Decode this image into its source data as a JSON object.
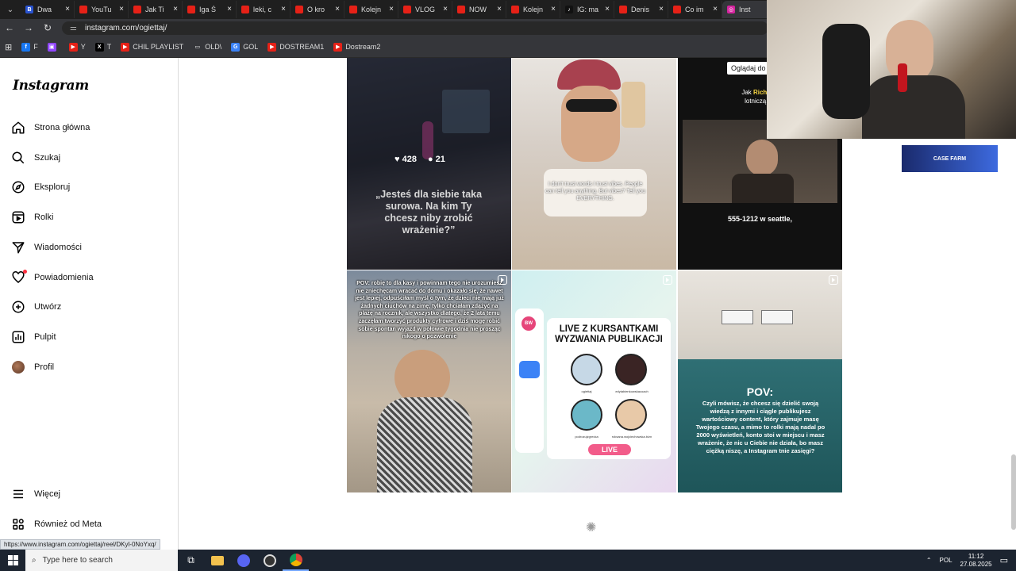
{
  "browser": {
    "tabs": [
      {
        "label": "Dwa",
        "fav_color": "#2a54d1",
        "fav_glyph": "B"
      },
      {
        "label": "YouTu",
        "fav_color": "#e62117",
        "fav_glyph": ""
      },
      {
        "label": "Jak Ti",
        "fav_color": "#e62117",
        "fav_glyph": ""
      },
      {
        "label": "Iga Ś",
        "fav_color": "#e62117",
        "fav_glyph": ""
      },
      {
        "label": "leki, c",
        "fav_color": "#e62117",
        "fav_glyph": ""
      },
      {
        "label": "O kro",
        "fav_color": "#e62117",
        "fav_glyph": ""
      },
      {
        "label": "Kolejn",
        "fav_color": "#e62117",
        "fav_glyph": ""
      },
      {
        "label": "VLOG",
        "fav_color": "#e62117",
        "fav_glyph": ""
      },
      {
        "label": "NOW",
        "fav_color": "#e62117",
        "fav_glyph": ""
      },
      {
        "label": "Kolejn",
        "fav_color": "#e62117",
        "fav_glyph": ""
      },
      {
        "label": "IG: ma",
        "fav_color": "#111111",
        "fav_glyph": "♪"
      },
      {
        "label": "Denis",
        "fav_color": "#e62117",
        "fav_glyph": ""
      },
      {
        "label": "Co im",
        "fav_color": "#e62117",
        "fav_glyph": ""
      },
      {
        "label": "Inst",
        "fav_color": "#d6249f",
        "fav_glyph": "◎",
        "active": true
      }
    ],
    "url": "instagram.com/ogiettaj/",
    "bookmarks": [
      {
        "label": "F",
        "fav_color": "#1877f2",
        "fav_glyph": "f"
      },
      {
        "label": "",
        "fav_color": "#9146ff",
        "fav_glyph": "▣"
      },
      {
        "label": "Y",
        "fav_color": "#e62117",
        "fav_glyph": "▶"
      },
      {
        "label": "T",
        "fav_color": "#000000",
        "fav_glyph": "X"
      },
      {
        "label": "CHIL PLAYLIST",
        "fav_color": "#e62117",
        "fav_glyph": "▶"
      },
      {
        "label": "OLD\\",
        "fav_color": "transparent",
        "fav_glyph": "▭"
      },
      {
        "label": "GOL",
        "fav_color": "#3b82f6",
        "fav_glyph": "G"
      },
      {
        "label": "DOSTREAM1",
        "fav_color": "#e62117",
        "fav_glyph": "▶"
      },
      {
        "label": "Dostream2",
        "fav_color": "#e62117",
        "fav_glyph": "▶"
      }
    ]
  },
  "instagram": {
    "logo": "Instagram",
    "nav": [
      {
        "label": "Strona główna",
        "icon": "home-icon"
      },
      {
        "label": "Szukaj",
        "icon": "search-icon"
      },
      {
        "label": "Eksploruj",
        "icon": "explore-icon"
      },
      {
        "label": "Rolki",
        "icon": "reels-icon"
      },
      {
        "label": "Wiadomości",
        "icon": "messages-icon"
      },
      {
        "label": "Powiadomienia",
        "icon": "heart-icon"
      },
      {
        "label": "Utwórz",
        "icon": "create-icon"
      },
      {
        "label": "Pulpit",
        "icon": "dashboard-icon"
      },
      {
        "label": "Profil",
        "icon": "avatar"
      }
    ],
    "more": "Więcej",
    "also_meta": "Również od Meta",
    "posts": [
      {
        "overlay": "„Jesteś dla siebie taka surowa. Na kim Ty chcesz niby zrobić wrażenie?”",
        "likes": "428",
        "comments": "21"
      },
      {
        "overlay": "I don't trust words I trust vibes. People can tell you anything. But vibes? Tell you EVERYTHING."
      },
      {
        "top_text_plain": "Oglądaj do",
        "top_text_a": "Jak ",
        "top_text_name": "Richard Brans",
        "top_text_b": "lotniczą, nie mają",
        "caption": "555-1212 w seattle,"
      },
      {
        "overlay": "POV: robię to dla kasy i powinnam tego nie urozumiesz nie zniechęcam wracać do domu i okazało się, że nawet jest lepiej, odpuściłam myśl o tym, że dzieci nie mają już żadnych ciuchów na zimę, tylko chciałam zdążyć na plażę na rocznik, ale wszystko dlatego, że 2 lata temu zaczęłam tworzyć produkty cyfrowe i dziś mogę robić sobie spontan wyjazd w połowie tygodnia nie prosząc nikogo o pozwolenie"
      },
      {
        "title": "LIVE Z KURSANTKAMI WYZWANIA PUBLIKACJI",
        "app_badge": "BW",
        "live_badge": "LIVE",
        "button": "LIVE",
        "guests": [
          "ogiettaj",
          "edytabienkowskacoach",
          "podrozujzgrecka",
          "roksana.wojciechowska.bizn"
        ]
      },
      {
        "title": "POV:",
        "overlay": "Czyli mówisz, że chcesz się dzielić swoją wiedzą z innymi i ciągle publikujesz wartościowy content, który zajmuje masę Twojego czasu, a mimo to rolki mają nadal po 2000 wyświetleń, konto stoi w miejscu i masz wrażenie, że nic u Ciebie nie działa, bo masz ciężką niszę, a Instagram tnie zasięgi?"
      }
    ]
  },
  "status_url": "https://www.instagram.com/ogiettaj/reel/DKyl-0NoYxq/",
  "ad_text": "CASE FARM",
  "taskbar": {
    "search_placeholder": "Type here to search",
    "lang": "POL",
    "time": "11:12",
    "date": "27.08.2025"
  }
}
